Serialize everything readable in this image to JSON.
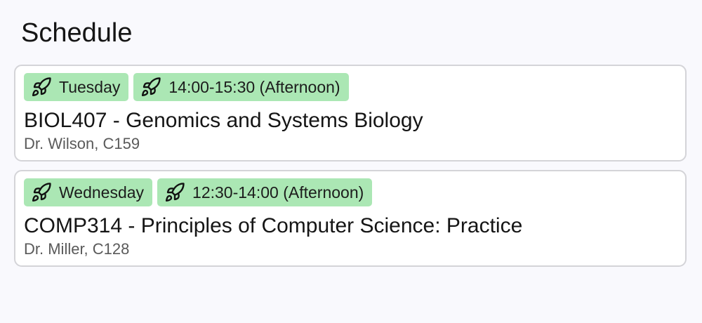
{
  "page": {
    "title": "Schedule"
  },
  "colors": {
    "background": "#f9f9fd",
    "card_border": "#d4d4d8",
    "tag_background": "#abe7b4",
    "meta_text": "#5a5a5a"
  },
  "tag_icon": "rocket-icon",
  "courses": [
    {
      "day": "Tuesday",
      "time": "14:00-15:30 (Afternoon)",
      "title": "BIOL407 - Genomics and Systems Biology",
      "meta": "Dr. Wilson, C159"
    },
    {
      "day": "Wednesday",
      "time": "12:30-14:00 (Afternoon)",
      "title": "COMP314 - Principles of Computer Science: Practice",
      "meta": "Dr. Miller, C128"
    }
  ]
}
